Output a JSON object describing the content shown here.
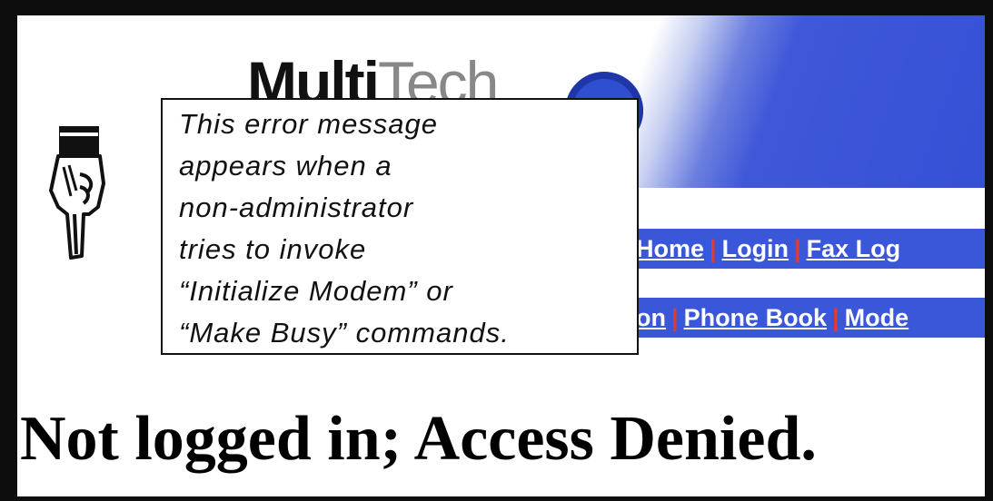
{
  "header": {
    "logo_name": "MultiTech",
    "logo_part_bold": "Multi",
    "logo_part_light": "Tech"
  },
  "nav": {
    "row1": [
      "Home",
      "Login",
      "Fax Log"
    ],
    "row2": [
      "on",
      "Phone Book",
      "Mode"
    ],
    "separator": "|"
  },
  "callout": {
    "lines": [
      "This error message",
      "appears when a",
      "non-administrator",
      "tries to invoke",
      "“Initialize Modem” or",
      "“Make Busy” commands."
    ],
    "icon": "pointing-hand-icon"
  },
  "page": {
    "error_message": "Not logged in; Access Denied."
  },
  "colors": {
    "frame": "#0d0d0d",
    "nav_bg": "#3a56d9",
    "nav_text": "#ffffff",
    "nav_separator": "#e03b2c",
    "banner_blue": "#3650d6"
  }
}
